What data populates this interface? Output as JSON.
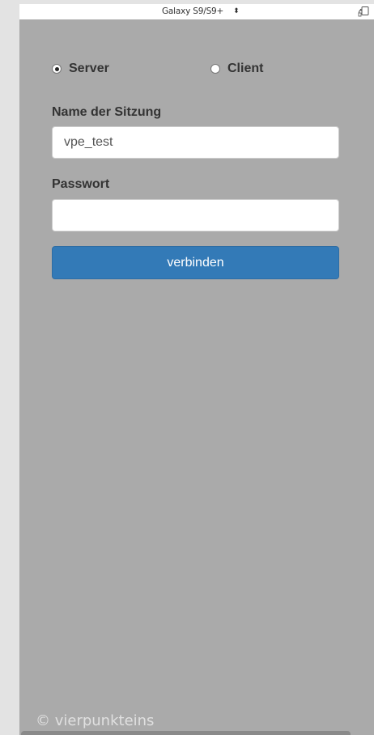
{
  "devtools": {
    "device_name": "Galaxy S9/S9+",
    "device_arrows": "⬍",
    "icons": {
      "rotate": "rotate-icon"
    }
  },
  "session": {
    "mode": {
      "selected": "server",
      "options": [
        {
          "id": "server",
          "label": "Server",
          "checked": true
        },
        {
          "id": "client",
          "label": "Client",
          "checked": false
        }
      ]
    },
    "name_label": "Name der Sitzung",
    "name_value": "vpe_test",
    "password_label": "Passwort",
    "password_value": "",
    "connect_label": "verbinden"
  },
  "footer": {
    "copyright": "© vierpunkteins"
  },
  "colors": {
    "page_background": "#e3e3e3",
    "screen_background": "#aaaaaa",
    "button_primary": "#337ab7",
    "text_dark": "#333333"
  }
}
